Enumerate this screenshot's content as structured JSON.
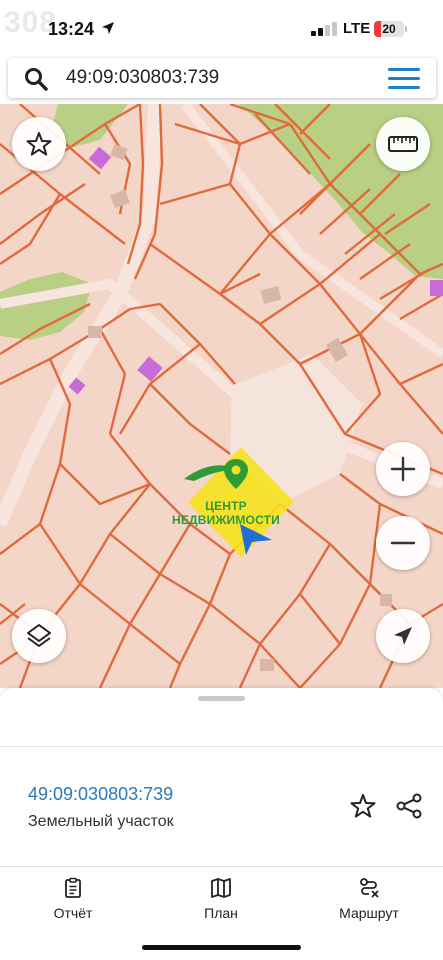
{
  "status_bar": {
    "time": "13:24",
    "network": "LTE",
    "battery_level": "20",
    "watermark": "308",
    "colors": {
      "battery_low": "#ef3b3b"
    }
  },
  "search": {
    "query": "49:09:030803:739",
    "icons": {
      "search": "search-icon",
      "menu": "menu-icon"
    }
  },
  "map": {
    "controls": {
      "favorites": "star-icon",
      "ruler": "ruler-icon",
      "zoom_in": "plus-icon",
      "zoom_out": "minus-icon",
      "layers": "layers-icon",
      "my_location": "navigation-arrow-icon"
    },
    "watermark_text": "ЦЕНТР НЕДВИЖИМОСТИ",
    "colors": {
      "land": "#f4d6c8",
      "parcel_border": "#e06a3c",
      "green_area": "#b8cf84",
      "building": "#d9b7a6",
      "poi": "#c86ad8",
      "logo_yellow": "#f6e21e",
      "logo_green": "#2e9b37",
      "user_arrow": "#1f6fd6"
    }
  },
  "sheet": {
    "parcel_number": "49:09:030803:739",
    "parcel_type": "Земельный участок",
    "icons": {
      "favorite": "star-outline-icon",
      "share": "share-icon"
    },
    "colors": {
      "link": "#2a7ab8"
    }
  },
  "tabbar": {
    "tabs": [
      {
        "label": "Отчёт",
        "icon": "report-icon"
      },
      {
        "label": "План",
        "icon": "map-icon"
      },
      {
        "label": "Маршрут",
        "icon": "route-icon"
      }
    ]
  }
}
